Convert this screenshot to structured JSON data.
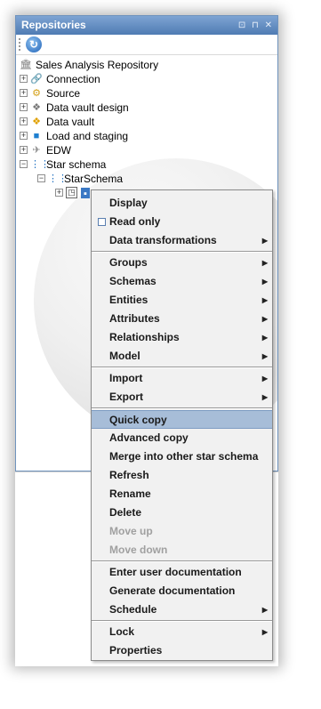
{
  "panel": {
    "title": "Repositories",
    "controls": "⊡ ⊓ ✕"
  },
  "tree": {
    "root": "Sales Analysis Repository",
    "items": [
      {
        "label": "Connection"
      },
      {
        "label": "Source"
      },
      {
        "label": "Data vault design"
      },
      {
        "label": "Data vault"
      },
      {
        "label": "Load and staging"
      },
      {
        "label": "EDW"
      },
      {
        "label": "Star schema"
      },
      {
        "label": "StarSchema"
      }
    ]
  },
  "menu": {
    "items": [
      "Display",
      "Read only",
      "Data transformations",
      "Groups",
      "Schemas",
      "Entities",
      "Attributes",
      "Relationships",
      "Model",
      "Import",
      "Export",
      "Quick copy",
      "Advanced copy",
      "Merge into other star schema",
      "Refresh",
      "Rename",
      "Delete",
      "Move up",
      "Move down",
      "Enter user documentation",
      "Generate documentation",
      "Schedule",
      "Lock",
      "Properties"
    ],
    "selected": "Quick copy",
    "disabled": [
      "Move up",
      "Move down"
    ]
  },
  "colors": {
    "titlebar": "#5f88bf",
    "selection": "#a7bdd8",
    "menu_bg": "#f1f1f1"
  }
}
